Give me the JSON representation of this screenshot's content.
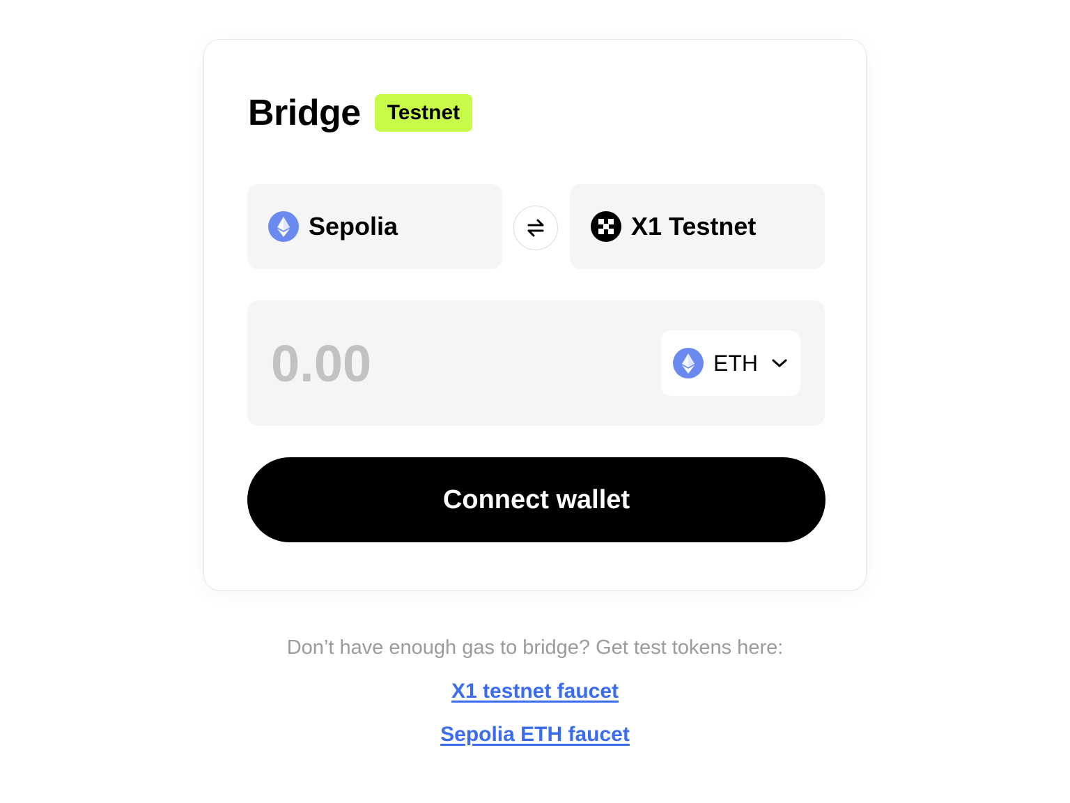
{
  "bridge": {
    "title": "Bridge",
    "badge": "Testnet"
  },
  "networks": {
    "from": {
      "label": "Sepolia",
      "icon": "ethereum-icon"
    },
    "to": {
      "label": "X1 Testnet",
      "icon": "x1-logo-icon"
    },
    "swap_icon": "swap-arrows-icon"
  },
  "amount": {
    "placeholder": "0.00",
    "token": {
      "label": "ETH",
      "icon": "ethereum-icon"
    }
  },
  "connect_button": "Connect wallet",
  "footer": {
    "hint": "Don’t have enough gas to bridge? Get test tokens here:",
    "links": [
      {
        "label": "X1 testnet faucet"
      },
      {
        "label": "Sepolia ETH faucet"
      }
    ]
  },
  "colors": {
    "badge": "#c8fa4a",
    "eth_icon": "#6b8af0",
    "link": "#3b6cf0",
    "panel": "#f5f5f5",
    "button": "#000000"
  }
}
